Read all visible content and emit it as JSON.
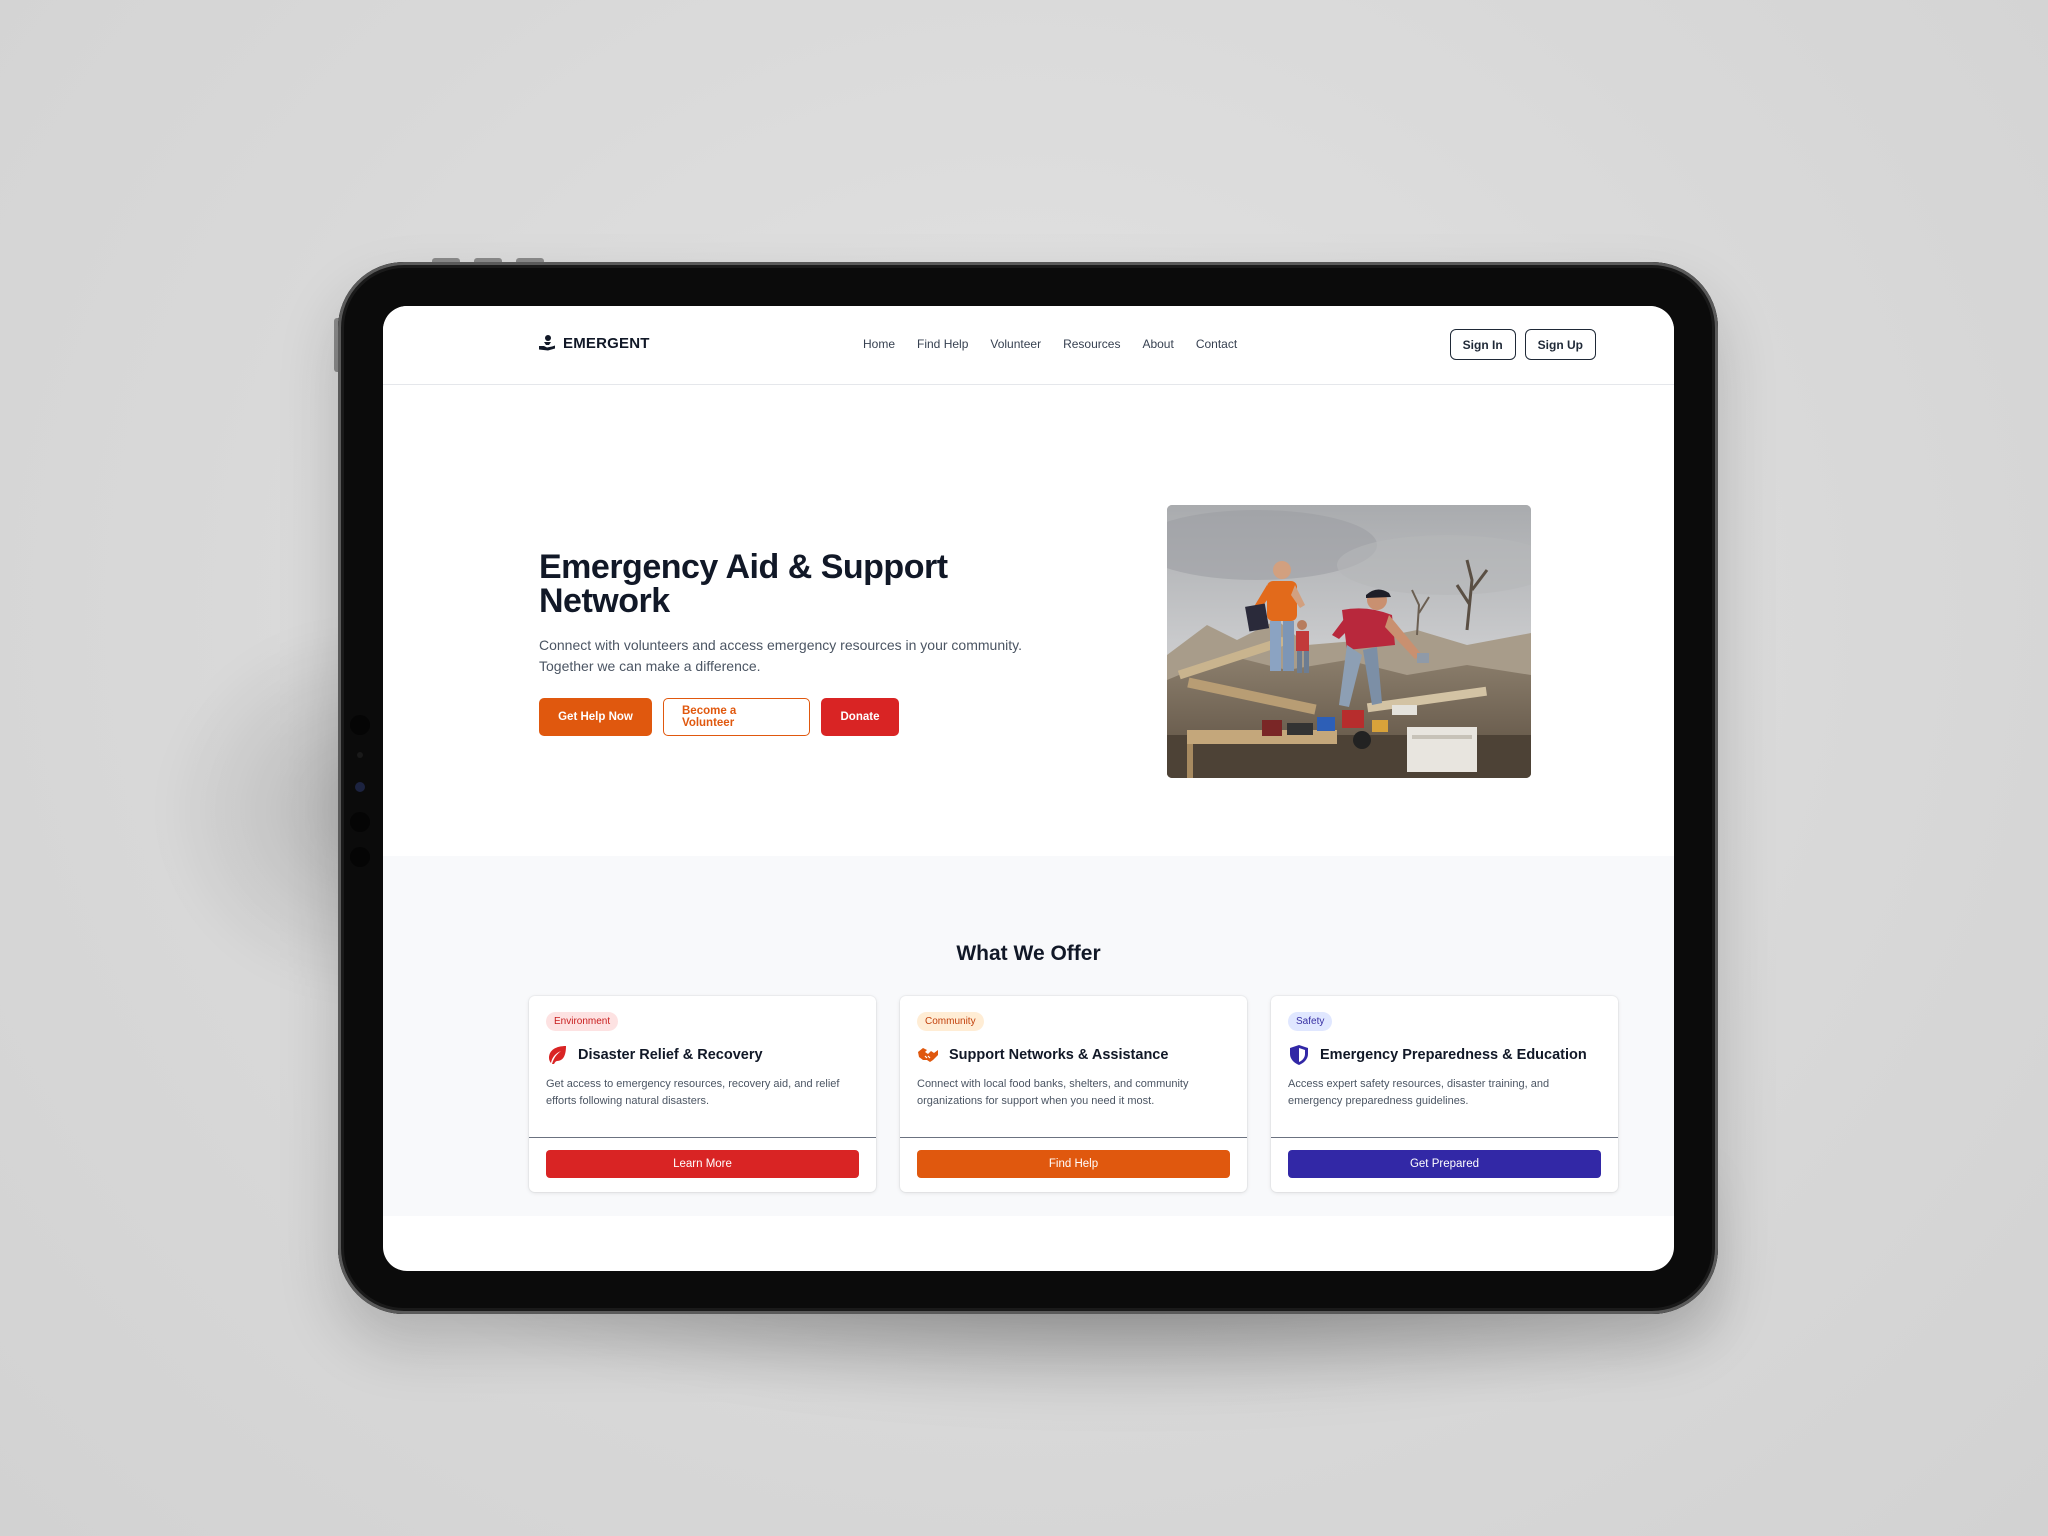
{
  "brand": {
    "name": "EMERGENT",
    "icon": "hand-person-icon"
  },
  "nav": {
    "items": [
      {
        "label": "Home"
      },
      {
        "label": "Find Help"
      },
      {
        "label": "Volunteer"
      },
      {
        "label": "Resources"
      },
      {
        "label": "About"
      },
      {
        "label": "Contact"
      }
    ]
  },
  "auth": {
    "sign_in": "Sign In",
    "sign_up": "Sign Up"
  },
  "hero": {
    "title": "Emergency Aid & Support Network",
    "subtitle_line1": "Connect with volunteers and access emergency resources in your community.",
    "subtitle_line2": "Together we can make a difference.",
    "buttons": {
      "primary": "Get Help Now",
      "secondary": "Become a Volunteer",
      "donate": "Donate"
    },
    "image": "volunteers-clearing-disaster-debris-photo"
  },
  "offers": {
    "title": "What We Offer",
    "cards": [
      {
        "badge": "Environment",
        "icon": "leaf-icon",
        "title": "Disaster Relief & Recovery",
        "description": "Get access to emergency resources, recovery aid, and relief efforts following natural disasters.",
        "button": "Learn More",
        "accent": "#d92424",
        "badge_bg": "#fde2e2",
        "badge_fg": "#c81e1e"
      },
      {
        "badge": "Community",
        "icon": "handshake-icon",
        "title": "Support Networks & Assistance",
        "description": "Connect with local food banks, shelters, and community organizations for support when you need it most.",
        "button": "Find Help",
        "accent": "#e0580e",
        "badge_bg": "#ffedd5",
        "badge_fg": "#c2410c"
      },
      {
        "badge": "Safety",
        "icon": "shield-icon",
        "title": "Emergency Preparedness & Education",
        "description": "Access expert safety resources, disaster training, and emergency preparedness guidelines.",
        "button": "Get Prepared",
        "accent": "#3228a6",
        "badge_bg": "#e0e7ff",
        "badge_fg": "#3730a3"
      }
    ]
  },
  "colors": {
    "orange": "#e0580e",
    "red": "#d92424",
    "indigo": "#3228a6",
    "text_dark": "#111827"
  }
}
